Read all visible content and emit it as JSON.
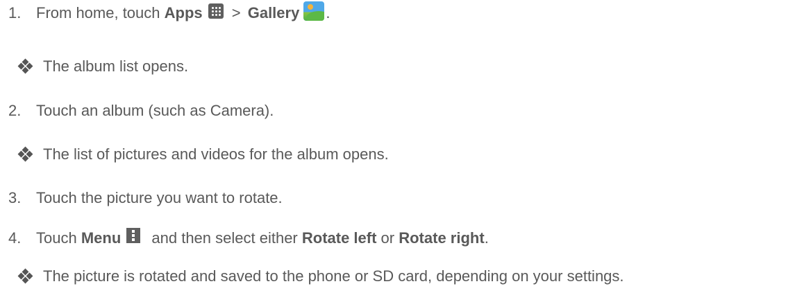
{
  "steps": [
    {
      "number": "1.",
      "prefix": "From home, touch ",
      "apps": "Apps",
      "sep": " > ",
      "gallery": "Gallery",
      "suffix": "."
    },
    {
      "number": "2.",
      "text": "Touch an album (such as Camera)."
    },
    {
      "number": "3.",
      "text": "Touch the picture you want to rotate."
    },
    {
      "number": "4.",
      "prefix": "Touch ",
      "menu": "Menu",
      "mid": " and then select either ",
      "rotate_left": "Rotate left",
      "or": " or ",
      "rotate_right": "Rotate right",
      "suffix": "."
    }
  ],
  "results": [
    "The album list opens.",
    "The list of pictures and videos for the album opens.",
    "The picture is rotated and saved to the phone or SD card, depending on your settings."
  ],
  "icons": {
    "bullet": "diamond-bullet-icon",
    "apps": "apps-grid-icon",
    "gallery": "gallery-icon",
    "menu": "menu-icon"
  }
}
